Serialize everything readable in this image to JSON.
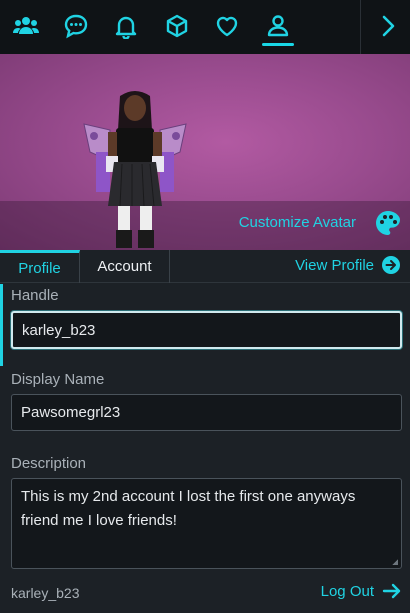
{
  "nav": {
    "items": [
      {
        "name": "friends",
        "icon": "friends-icon"
      },
      {
        "name": "chat",
        "icon": "chat-icon"
      },
      {
        "name": "notifications",
        "icon": "bell-icon"
      },
      {
        "name": "inventory",
        "icon": "cube-icon"
      },
      {
        "name": "favorites",
        "icon": "heart-icon"
      },
      {
        "name": "profile",
        "icon": "user-icon",
        "active": true
      }
    ],
    "expand_icon": "chevron-right-icon"
  },
  "avatar": {
    "customize_label": "Customize Avatar",
    "customize_icon": "palette-icon"
  },
  "tabs": {
    "profile": "Profile",
    "account": "Account",
    "view_profile": "View Profile"
  },
  "form": {
    "handle": {
      "label": "Handle",
      "value": "karley_b23"
    },
    "display_name": {
      "label": "Display Name",
      "value": "Pawsomegrl23"
    },
    "description": {
      "label": "Description",
      "value": "This is my 2nd account I lost the first one anyways friend me I love friends!"
    }
  },
  "footer": {
    "username": "karley_b23",
    "logout_label": "Log Out"
  },
  "colors": {
    "accent": "#20d3e3",
    "background": "#1c2126",
    "nav_background": "#0f1316",
    "avatar_background": "#9a4c8f"
  }
}
